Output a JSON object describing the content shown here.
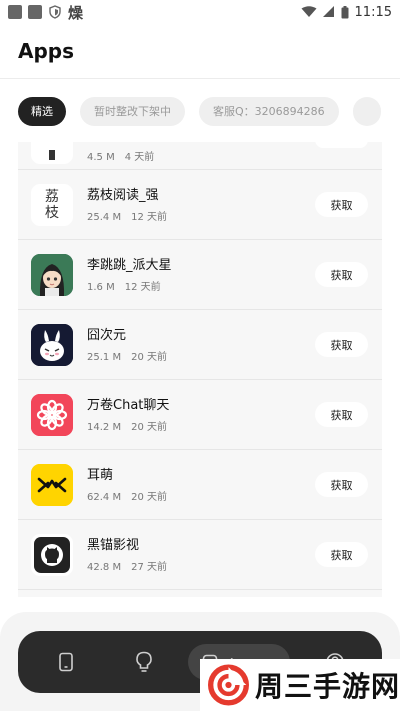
{
  "status_bar": {
    "time": "11:15",
    "extra": "燥"
  },
  "header": {
    "title": "Apps"
  },
  "chips": [
    {
      "label": "精选",
      "active": true
    },
    {
      "label": "暂时整改下架中",
      "active": false
    },
    {
      "label": "客服Q：3206894286",
      "active": false
    },
    {
      "label": "",
      "active": false
    }
  ],
  "apps": [
    {
      "name": "",
      "size": "4.5 M",
      "time": "4 天前",
      "button": "获取",
      "icon": "partial-app-icon"
    },
    {
      "name": "荔枝阅读_强",
      "size": "25.4 M",
      "time": "12 天前",
      "button": "获取",
      "icon": "lizhi-reader-icon",
      "icon_text": "荔枝"
    },
    {
      "name": "李跳跳_派大星",
      "size": "1.6 M",
      "time": "12 天前",
      "button": "获取",
      "icon": "anime-girl-icon"
    },
    {
      "name": "囧次元",
      "size": "25.1 M",
      "time": "20 天前",
      "button": "获取",
      "icon": "white-rabbit-icon"
    },
    {
      "name": "万卷Chat聊天",
      "size": "14.2 M",
      "time": "20 天前",
      "button": "获取",
      "icon": "red-flower-icon"
    },
    {
      "name": "耳萌",
      "size": "62.4 M",
      "time": "20 天前",
      "button": "获取",
      "icon": "yellow-m-icon"
    },
    {
      "name": "黑锚影视",
      "size": "42.8 M",
      "time": "27 天前",
      "button": "获取",
      "icon": "github-icon"
    }
  ],
  "bottom_nav": {
    "items": [
      "phone-icon",
      "bulb-icon",
      "apps-icon",
      "user-icon"
    ],
    "active_label": "Apps"
  },
  "watermark": {
    "text": "周三手游网"
  },
  "colors": {
    "chip_active": "#222222",
    "card_bg": "#f7f7f7",
    "nav_bg": "#2b2b2b",
    "watermark_red": "#e53a2e"
  }
}
